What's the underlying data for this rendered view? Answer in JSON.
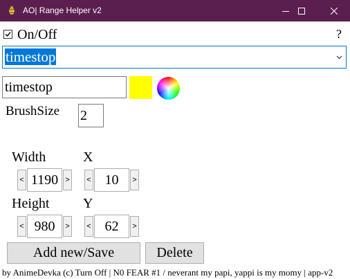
{
  "window": {
    "title": "AO| Range Helper v2",
    "app_icon": "bug-app-icon",
    "controls": [
      "minimize-icon",
      "maximize-icon",
      "close-icon"
    ],
    "titlebar_color": "#5a1f4e"
  },
  "toggle": {
    "checked": true,
    "check_glyph": "☑",
    "label": "On/Off"
  },
  "help": {
    "label": "?"
  },
  "preset": {
    "selected": "timestop",
    "accent": "#0078d7"
  },
  "name_field": {
    "value": "timestop"
  },
  "color": {
    "swatch": "#ffff00",
    "picker_icon": "color-wheel-icon"
  },
  "brush": {
    "label": "BrushSize",
    "value": "2"
  },
  "geometry": {
    "width": {
      "label": "Width",
      "value": "1190"
    },
    "x": {
      "label": "X",
      "value": "10"
    },
    "height": {
      "label": "Height",
      "value": "980"
    },
    "y": {
      "label": "Y",
      "value": "62"
    },
    "decrement_glyph": "<",
    "increment_glyph": ">"
  },
  "actions": {
    "add_save": "Add new/Save",
    "delete": "Delete"
  },
  "status": {
    "text": "by AnimeDevka (c) Turn Off | N0 FEAR #1 / neverant my papi, yappi is my momy | app-v2"
  }
}
